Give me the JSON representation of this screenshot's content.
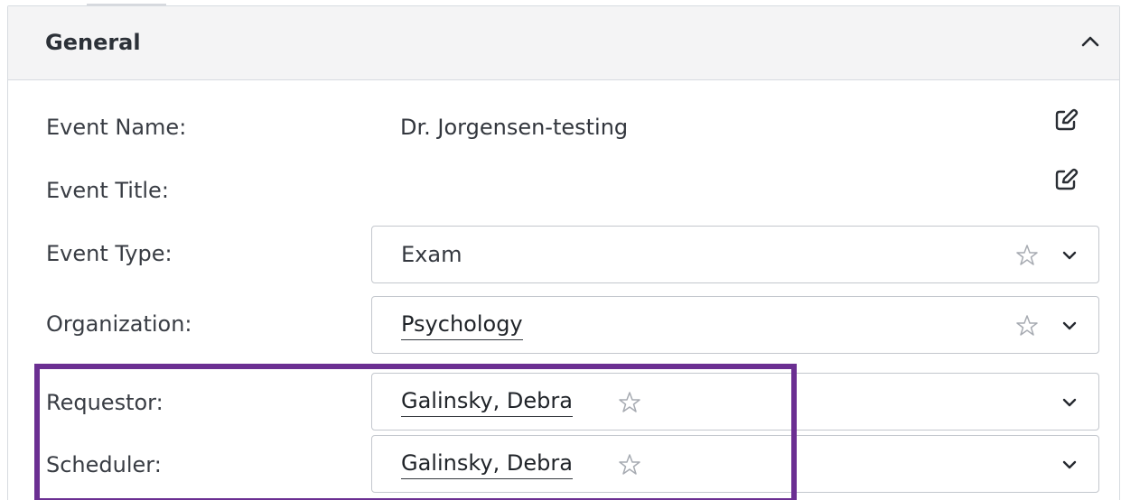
{
  "section": {
    "title": "General",
    "collapse_icon": "chevron-up-icon"
  },
  "fields": {
    "event_name": {
      "label": "Event Name:",
      "value": "Dr. Jorgensen-testing",
      "action_icon": "edit-icon"
    },
    "event_title": {
      "label": "Event Title:",
      "value": "",
      "action_icon": "edit-icon"
    },
    "event_type": {
      "label": "Event Type:",
      "value": "Exam",
      "favorite_icon": "star-icon",
      "dropdown_icon": "chevron-down-icon"
    },
    "organization": {
      "label": "Organization:",
      "value": "Psychology",
      "favorite_icon": "star-icon",
      "dropdown_icon": "chevron-down-icon"
    },
    "requestor": {
      "label": "Requestor:",
      "value": "Galinsky, Debra",
      "favorite_icon": "star-icon",
      "dropdown_icon": "chevron-down-icon"
    },
    "scheduler": {
      "label": "Scheduler:",
      "value": "Galinsky, Debra",
      "favorite_icon": "star-icon",
      "dropdown_icon": "chevron-down-icon"
    }
  },
  "colors": {
    "highlight": "#6b2f92",
    "header_bg": "#f4f4f5",
    "border": "#d7dbe0"
  }
}
